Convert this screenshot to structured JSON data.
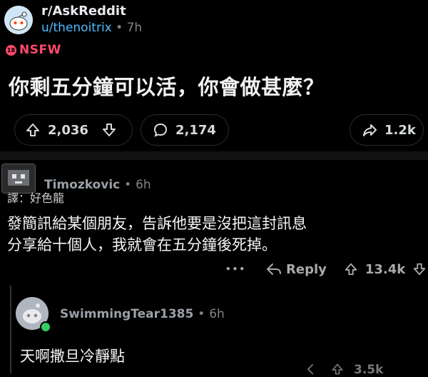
{
  "post": {
    "subreddit": "r/AskReddit",
    "username": "u/thenoitrix",
    "separator": "•",
    "time": "7h",
    "nsfw_badge": "18",
    "nsfw_label": "NSFW",
    "title": "你剩五分鐘可以活，你會做甚麼？",
    "upvotes": "2,036",
    "comments": "2,174",
    "shares": "1.2k"
  },
  "comment": {
    "username": "Timozkovic",
    "separator": "•",
    "time": "6h",
    "translator_label": "譯：好色龍",
    "body_line1": "發簡訊給某個朋友，告訴他要是沒把這封訊息",
    "body_line2": "分享給十個人，我就會在五分鐘後死掉。",
    "more": "•••",
    "reply_label": "Reply",
    "votes": "13.4k"
  },
  "reply": {
    "username": "SwimmingTear1385",
    "separator": "•",
    "time": "6h",
    "body": "天啊撒旦冷靜點",
    "votes_partial": "3.5k"
  },
  "colors": {
    "background": "#000000",
    "nsfw": "#ff4a6a",
    "username_link": "#4fbcff",
    "online": "#33cc66"
  },
  "icons": [
    "snoo-avatar-icon",
    "nsfw-icon",
    "upvote-icon",
    "downvote-icon",
    "comment-icon",
    "share-icon",
    "reply-icon"
  ]
}
